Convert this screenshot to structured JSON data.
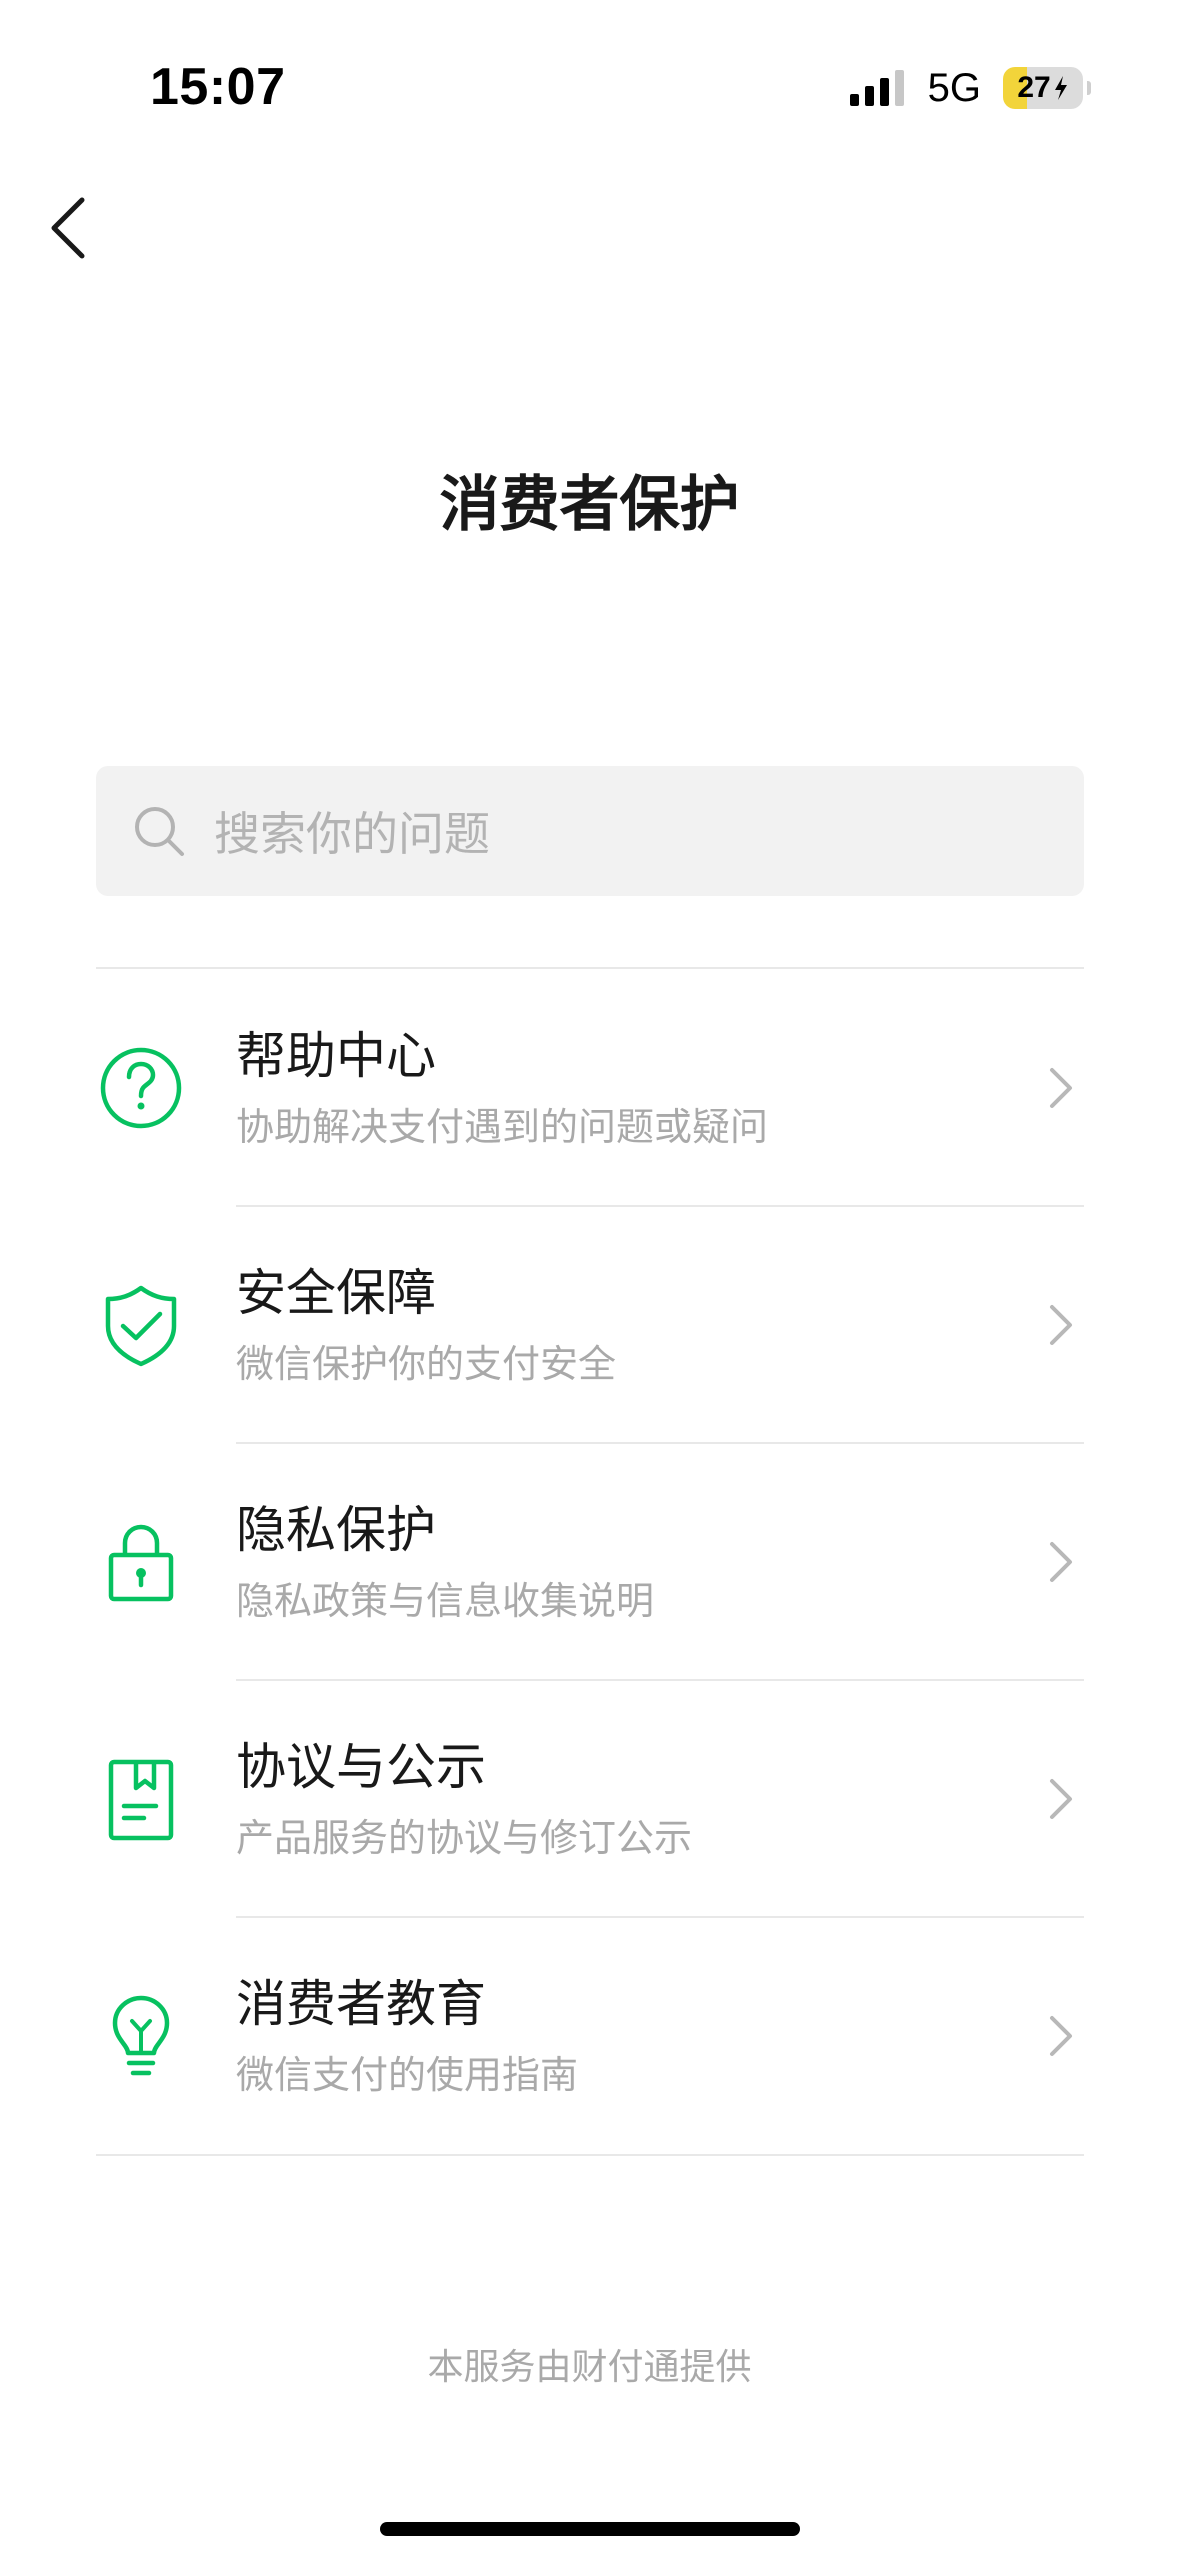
{
  "status_bar": {
    "time": "15:07",
    "network": "5G",
    "battery": "27"
  },
  "header": {
    "title": "消费者保护"
  },
  "search": {
    "placeholder": "搜索你的问题"
  },
  "menu": {
    "items": [
      {
        "title": "帮助中心",
        "subtitle": "协助解决支付遇到的问题或疑问",
        "icon": "help-question-icon"
      },
      {
        "title": "安全保障",
        "subtitle": "微信保护你的支付安全",
        "icon": "shield-check-icon"
      },
      {
        "title": "隐私保护",
        "subtitle": "隐私政策与信息收集说明",
        "icon": "lock-icon"
      },
      {
        "title": "协议与公示",
        "subtitle": "产品服务的协议与修订公示",
        "icon": "document-bookmark-icon"
      },
      {
        "title": "消费者教育",
        "subtitle": "微信支付的使用指南",
        "icon": "lightbulb-icon"
      }
    ]
  },
  "footer": {
    "text": "本服务由财付通提供"
  },
  "colors": {
    "accent_green": "#07c160",
    "text_primary": "#191919",
    "text_secondary": "#a9a9a9",
    "battery_fill": "#f2d43a"
  }
}
